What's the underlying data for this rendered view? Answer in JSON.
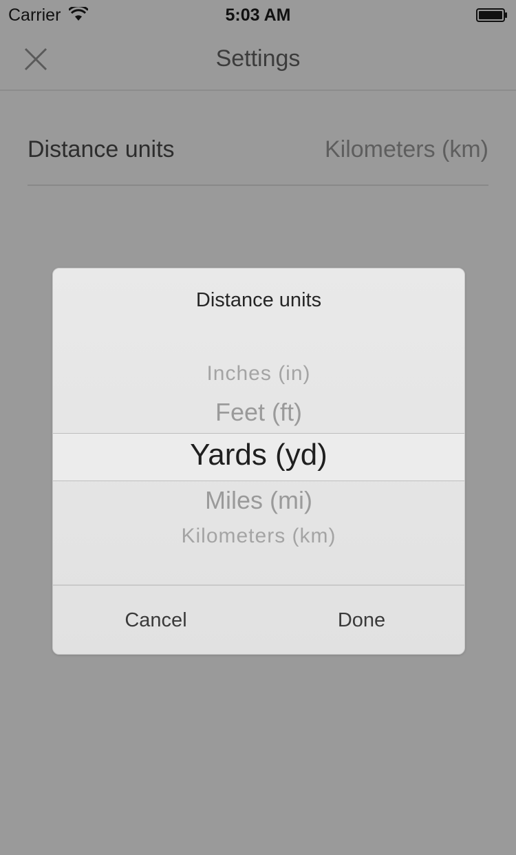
{
  "status_bar": {
    "carrier": "Carrier",
    "time": "5:03 AM",
    "wifi_icon": "wifi-icon",
    "battery_icon": "battery-icon"
  },
  "nav": {
    "title": "Settings",
    "close_icon": "close-icon"
  },
  "settings": {
    "distance_units": {
      "label": "Distance units",
      "value": "Kilometers (km)"
    }
  },
  "dialog": {
    "title": "Distance units",
    "options": [
      "Inches (in)",
      "Feet (ft)",
      "Yards (yd)",
      "Miles (mi)",
      "Kilometers (km)"
    ],
    "selected": "Yards (yd)",
    "cancel_label": "Cancel",
    "done_label": "Done"
  },
  "colors": {
    "overlay_background": "#9a9a9a",
    "dialog_background": "#e6e6e6",
    "selected_text": "#1f1f1f",
    "unselected_text": "#9d9d9d"
  }
}
